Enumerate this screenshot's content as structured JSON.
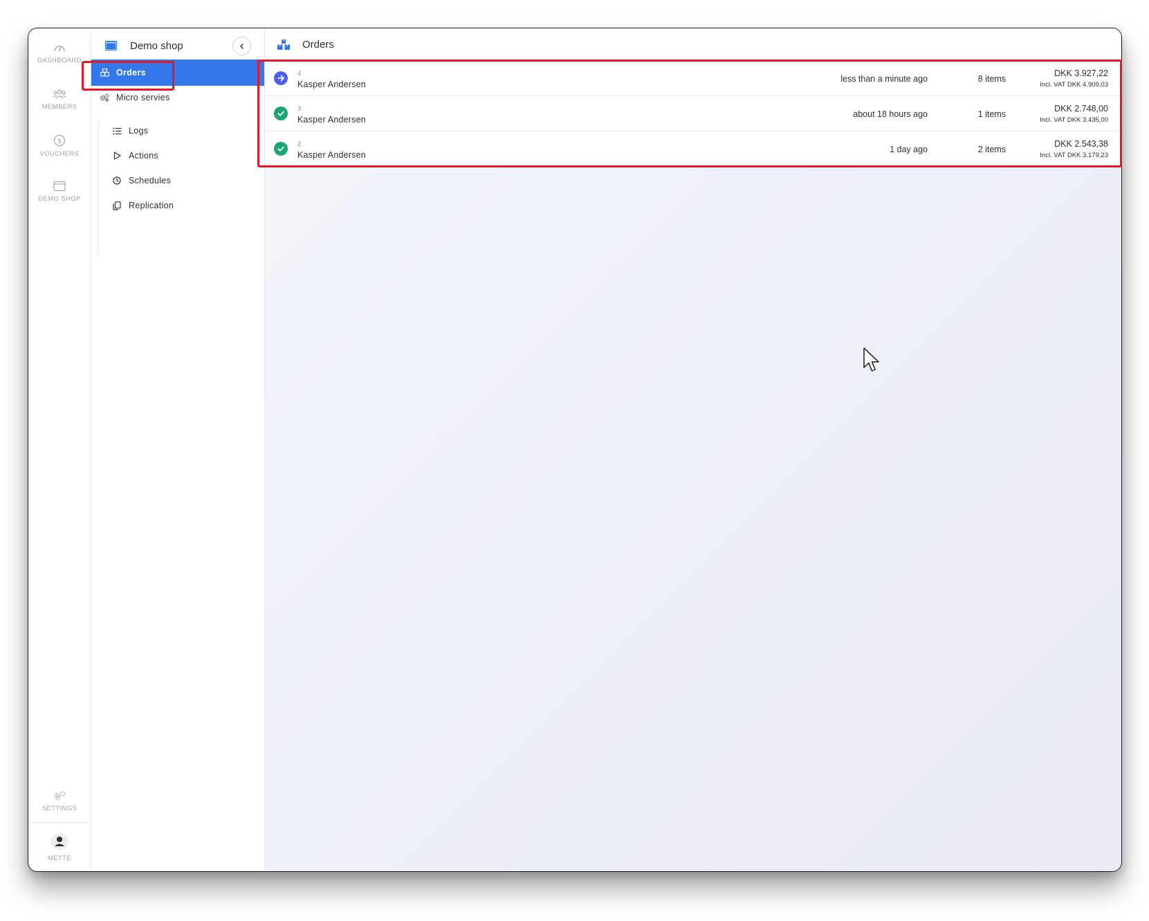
{
  "rail": {
    "items": [
      {
        "label": "DASHBOARD",
        "icon": "gauge-icon"
      },
      {
        "label": "MEMBERS",
        "icon": "users-icon"
      },
      {
        "label": "VOUCHERS",
        "icon": "dollar-circle-icon"
      },
      {
        "label": "DEMO SHOP",
        "icon": "browser-window-icon"
      }
    ],
    "settings_label": "SETTINGS",
    "user_label": "METTE"
  },
  "sidebar": {
    "title": "Demo shop",
    "items": [
      {
        "label": "Orders",
        "icon": "boxes-icon",
        "active": true
      },
      {
        "label": "Micro servies",
        "icon": "gears-icon",
        "active": false
      }
    ],
    "sub_items": [
      {
        "label": "Logs",
        "icon": "list-icon"
      },
      {
        "label": "Actions",
        "icon": "play-icon"
      },
      {
        "label": "Schedules",
        "icon": "clock-icon"
      },
      {
        "label": "Replication",
        "icon": "copy-icon"
      }
    ]
  },
  "main": {
    "title": "Orders",
    "orders": [
      {
        "number": "4",
        "customer": "Kasper Andersen",
        "time": "less than a minute ago",
        "items": "8 items",
        "total": "DKK 3.927,22",
        "vat": "Incl. VAT DKK 4.909,03",
        "status": "in-progress"
      },
      {
        "number": "3",
        "customer": "Kasper Andersen",
        "time": "about 18 hours ago",
        "items": "1 items",
        "total": "DKK 2.748,00",
        "vat": "Incl. VAT DKK 3.435,00",
        "status": "completed"
      },
      {
        "number": "2",
        "customer": "Kasper Andersen",
        "time": "1 day ago",
        "items": "2 items",
        "total": "DKK 2.543,38",
        "vat": "Incl. VAT DKK 3.179,23",
        "status": "completed"
      }
    ]
  },
  "colors": {
    "accent": "#3377e8",
    "status_in_progress": "#4d5ff0",
    "status_completed": "#1ea672",
    "highlight": "#e2172a"
  }
}
